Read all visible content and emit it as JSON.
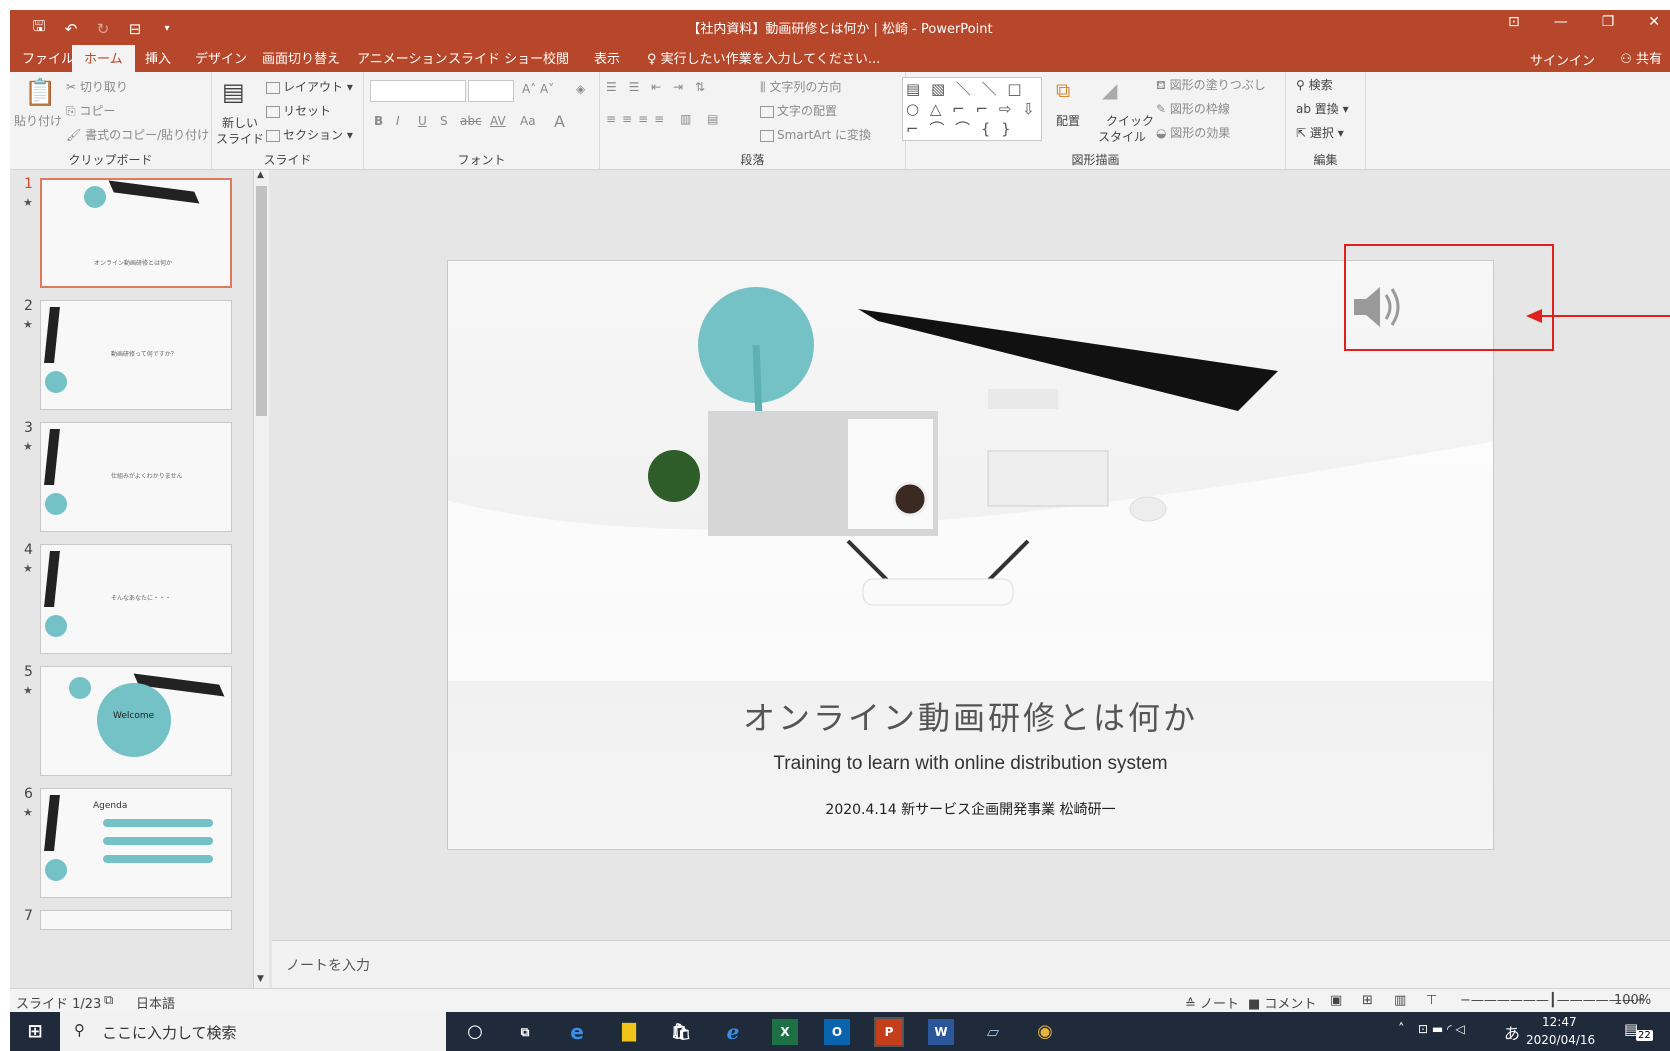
{
  "window": {
    "title": "【社内資料】動画研修とは何か | 松崎 - PowerPoint",
    "controls": [
      "⊡",
      "—",
      "❐",
      "✕"
    ]
  },
  "tabs": [
    "ファイル",
    "ホーム",
    "挿入",
    "デザイン",
    "画面切り替え",
    "アニメーション",
    "スライド ショー",
    "校閲",
    "表示"
  ],
  "tell_me": "♀ 実行したい作業を入力してください...",
  "signin": "サインイン",
  "share": "⚇ 共有",
  "ribbon": {
    "clipboard": {
      "label": "クリップボード",
      "paste": "貼り付け",
      "cut": "切り取り",
      "copy": "コピー",
      "format_painter": "書式のコピー/貼り付け"
    },
    "slides": {
      "label": "スライド",
      "new_slide_1": "新しい",
      "new_slide_2": "スライド",
      "layout": "レイアウト",
      "reset": "リセット",
      "section": "セクション"
    },
    "font": {
      "label": "フォント",
      "bold": "B",
      "italic": "I",
      "underline": "U",
      "shadow": "S",
      "strike": "abc",
      "spacing": "AV",
      "case": "Aa"
    },
    "paragraph": {
      "label": "段落",
      "text_direction": "文字列の方向",
      "align_text": "文字の配置",
      "smartart": "SmartArt に変換"
    },
    "drawing": {
      "label": "図形描画",
      "arrange": "配置",
      "quick_styles_1": "クイック",
      "quick_styles_2": "スタイル",
      "shape_fill": "図形の塗りつぶし",
      "shape_outline": "図形の枠線",
      "shape_effects": "図形の効果",
      "shapes_gallery": "▤ ▧ ＼ ＼ □ ○ △ ⌐ ⌐ ⇨ ⇩ ⌐ ⌒ ⌒ { }"
    },
    "editing": {
      "label": "編集",
      "find": "検索",
      "replace": "置換",
      "select": "選択"
    }
  },
  "thumbnails": [
    {
      "num": "1",
      "text": "オンライン動画研修とは何か",
      "selected": true
    },
    {
      "num": "2",
      "text": "動画研修って何ですか？",
      "selected": false
    },
    {
      "num": "3",
      "text": "仕組みがよくわかりません",
      "selected": false
    },
    {
      "num": "4",
      "text": "そんなあなたに・・・",
      "selected": false
    },
    {
      "num": "5",
      "text": "Welcome",
      "selected": false
    },
    {
      "num": "6",
      "text": "Agenda",
      "selected": false
    },
    {
      "num": "7",
      "text": "",
      "selected": false
    }
  ],
  "slide": {
    "title": "オンライン動画研修とは何か",
    "subtitle": "Training to learn with online distribution system",
    "author": "2020.4.14  新サービス企画開発事業  松崎研一"
  },
  "notes_placeholder": "ノートを入力",
  "status": {
    "slide_count": "スライド 1/23",
    "language": "日本語",
    "notes": "≙ ノート",
    "comments": "■ コメント",
    "zoom": "100%"
  },
  "taskbar": {
    "search_placeholder": "ここに入力して検索",
    "time": "12:47",
    "date": "2020/04/16",
    "ime": "あ",
    "notifications": "22"
  },
  "colors": {
    "accent": "#b7472a",
    "teal": "#74c2c5",
    "annotation": "#e0201a"
  }
}
